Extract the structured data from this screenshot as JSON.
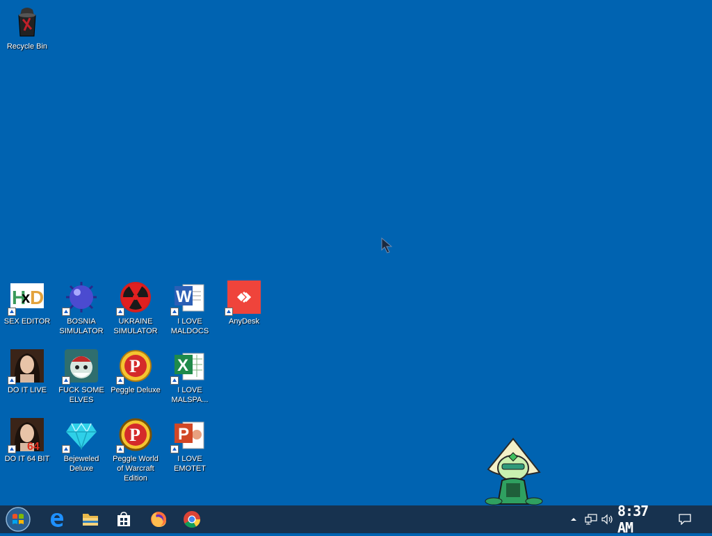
{
  "desktop_icons": {
    "recycle_bin": "Recycle Bin",
    "sex_editor": "SEX EDITOR",
    "bosnia": "BOSNIA SIMULATOR",
    "ukraine": "UKRAINE SIMULATOR",
    "maldocs": "I LOVE MALDOCS",
    "anydesk": "AnyDesk",
    "do_it_live": "DO IT LIVE",
    "elves": "FUCK SOME ELVES",
    "peggle": "Peggle Deluxe",
    "malspa": "I LOVE MALSPA...",
    "do_it_64": "DO IT 64 BIT",
    "bejeweled": "Bejeweled Deluxe",
    "peggle_wow": "Peggle World of Warcraft Edition",
    "emotet": "I LOVE EMOTET"
  },
  "taskbar": {
    "pinned": [
      "start-orb-icon",
      "edge-icon",
      "file-explorer-icon",
      "store-icon",
      "firefox-icon",
      "chrome-icon"
    ],
    "clock": "8:37 AM"
  },
  "colors": {
    "desktop_bg": "#0063B1",
    "taskbar_bg": "#17324f"
  }
}
